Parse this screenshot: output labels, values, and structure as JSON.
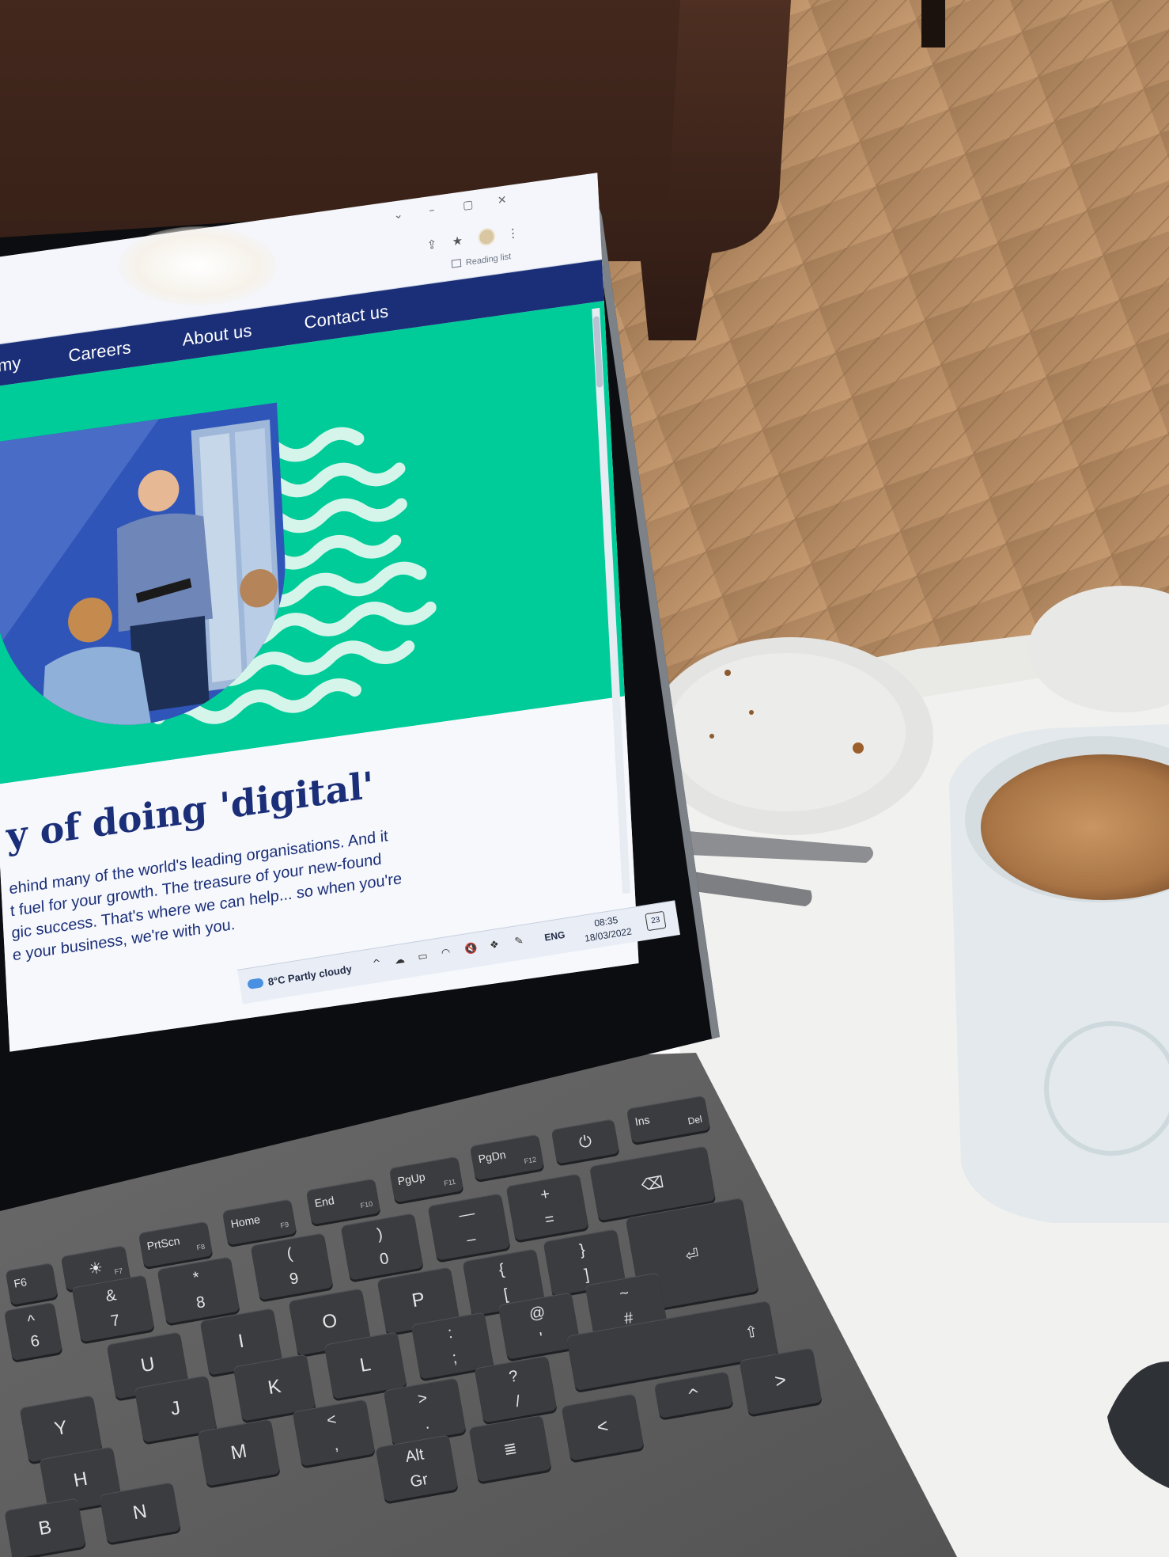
{
  "browser": {
    "window_controls": [
      "⌄",
      "–",
      "▢",
      "✕"
    ],
    "toolbar_icons": {
      "share": "share-icon",
      "bookmark": "★",
      "menu": "⋮"
    },
    "reading_list_label": "Reading list"
  },
  "site": {
    "nav": {
      "items": [
        {
          "label": "my"
        },
        {
          "label": "Careers"
        },
        {
          "label": "About us"
        },
        {
          "label": "Contact us"
        }
      ]
    },
    "headline": "y of doing 'digital'",
    "paragraph_lines": [
      "ehind many of the world's leading organisations. And it",
      "t fuel for your growth. The treasure of your new-found",
      "gic success. That's where we can help... so when you're",
      "e your business, we're with you."
    ],
    "colors": {
      "nav_bg": "#1b2f78",
      "hero_bg": "#00cc99",
      "headline": "#1b2f78"
    }
  },
  "taskbar": {
    "weather": "8°C Partly cloudy",
    "tray_chevron": "^",
    "language": "ENG",
    "time": "08:35",
    "date": "18/03/2022",
    "notification_count": "23"
  },
  "keyboard": {
    "fn_row": [
      {
        "label": "F6",
        "sub": "F6"
      },
      {
        "label": "☀",
        "sub": "F7"
      },
      {
        "label": "PrtScn",
        "sub": "F8"
      },
      {
        "label": "Home",
        "sub": "F9"
      },
      {
        "label": "End",
        "sub": "F10"
      },
      {
        "label": "PgUp",
        "sub": "F11"
      },
      {
        "label": "PgDn",
        "sub": "F12"
      },
      {
        "label": "⏻",
        "sub": ""
      },
      {
        "label": "Del",
        "sub": "Ins"
      }
    ],
    "number_row": [
      {
        "top": "&",
        "bot": "7"
      },
      {
        "top": "*",
        "bot": "8"
      },
      {
        "top": "(",
        "bot": "9"
      },
      {
        "top": ")",
        "bot": "0"
      },
      {
        "top": "—",
        "bot": "–"
      },
      {
        "top": "+",
        "bot": "="
      },
      {
        "top": "⌫",
        "bot": ""
      }
    ],
    "top_row": [
      {
        "label": "U"
      },
      {
        "label": "I"
      },
      {
        "label": "O"
      },
      {
        "label": "P"
      },
      {
        "top": "{",
        "bot": "["
      },
      {
        "top": "}",
        "bot": "]"
      },
      {
        "label": "⏎"
      }
    ],
    "home_row": [
      {
        "label": "Y"
      },
      {
        "label": "J"
      },
      {
        "label": "K"
      },
      {
        "label": "L"
      },
      {
        "top": ":",
        "bot": ";"
      },
      {
        "top": "@",
        "bot": "'"
      },
      {
        "top": "~",
        "bot": "#"
      }
    ],
    "bottom_row": [
      {
        "label": "H"
      },
      {
        "label": "M"
      },
      {
        "top": "<",
        "bot": ","
      },
      {
        "top": ">",
        "bot": "."
      },
      {
        "top": "?",
        "bot": "/"
      },
      {
        "label": "⇧"
      }
    ],
    "space_row": [
      {
        "label": "B"
      },
      {
        "label": "N"
      },
      {
        "top": "Alt",
        "bot": "Gr"
      },
      {
        "label": "≣"
      },
      {
        "label": "<"
      },
      {
        "label": "^"
      },
      {
        "label": ">"
      }
    ],
    "left_edge": [
      {
        "label": "^"
      },
      {
        "label": "6"
      }
    ]
  }
}
